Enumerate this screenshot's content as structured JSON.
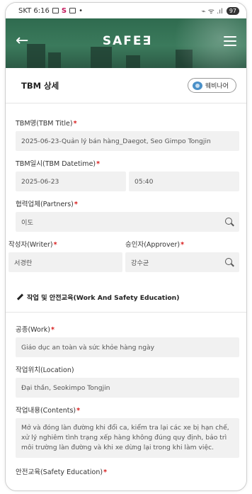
{
  "status_bar": {
    "carrier_time": "SKT 6:16",
    "s_icon": "S",
    "right_icons": "⌁ ᯤ .ıl",
    "battery": "97"
  },
  "header": {
    "logo": "SAFE",
    "logo_suffix": "∃",
    "back_icon": "arrow-left-icon",
    "menu_icon": "hamburger-menu-icon",
    "colors": {
      "header_bg": "#3b7a5c",
      "required": "#d81b1b"
    }
  },
  "title_bar": {
    "title": "TBM 상세",
    "webinar_label": "웨비나어"
  },
  "form": {
    "title": {
      "label": "TBM명(TBM Title)",
      "value": "2025-06-23-Quản lý bán hàng_Daegot, Seo Gimpo Tongjin"
    },
    "datetime": {
      "label": "TBM일시(TBM Datetime)",
      "date": "2025-06-23",
      "time": "05:40"
    },
    "partners": {
      "label": "협력업체(Partners)",
      "value": "이도"
    },
    "writer": {
      "label": "작성자(Writer)",
      "value": "서경란"
    },
    "approver": {
      "label": "승인자(Approver)",
      "value": "강수균"
    },
    "section_title": "작업 및 안전교육(Work And Safety Education)",
    "work": {
      "label": "공종(Work)",
      "value": "Giáo dục an toàn và sức khỏe hàng ngày"
    },
    "location": {
      "label": "작업위치(Location)",
      "value": "Đại thần, Seokimpo Tongjin"
    },
    "contents": {
      "label": "작업내용(Contents)",
      "value": "Mở và đóng làn đường khi đổi ca, kiểm tra lại các xe bị hạn chế, xử lý nghiêm tình trạng xếp hàng không đúng quy định, bảo trì môi trường làn đường và khi xe dừng lại trong khi làm việc."
    },
    "safety": {
      "label": "안전교육(Safety Education)"
    },
    "required_mark": "*"
  }
}
